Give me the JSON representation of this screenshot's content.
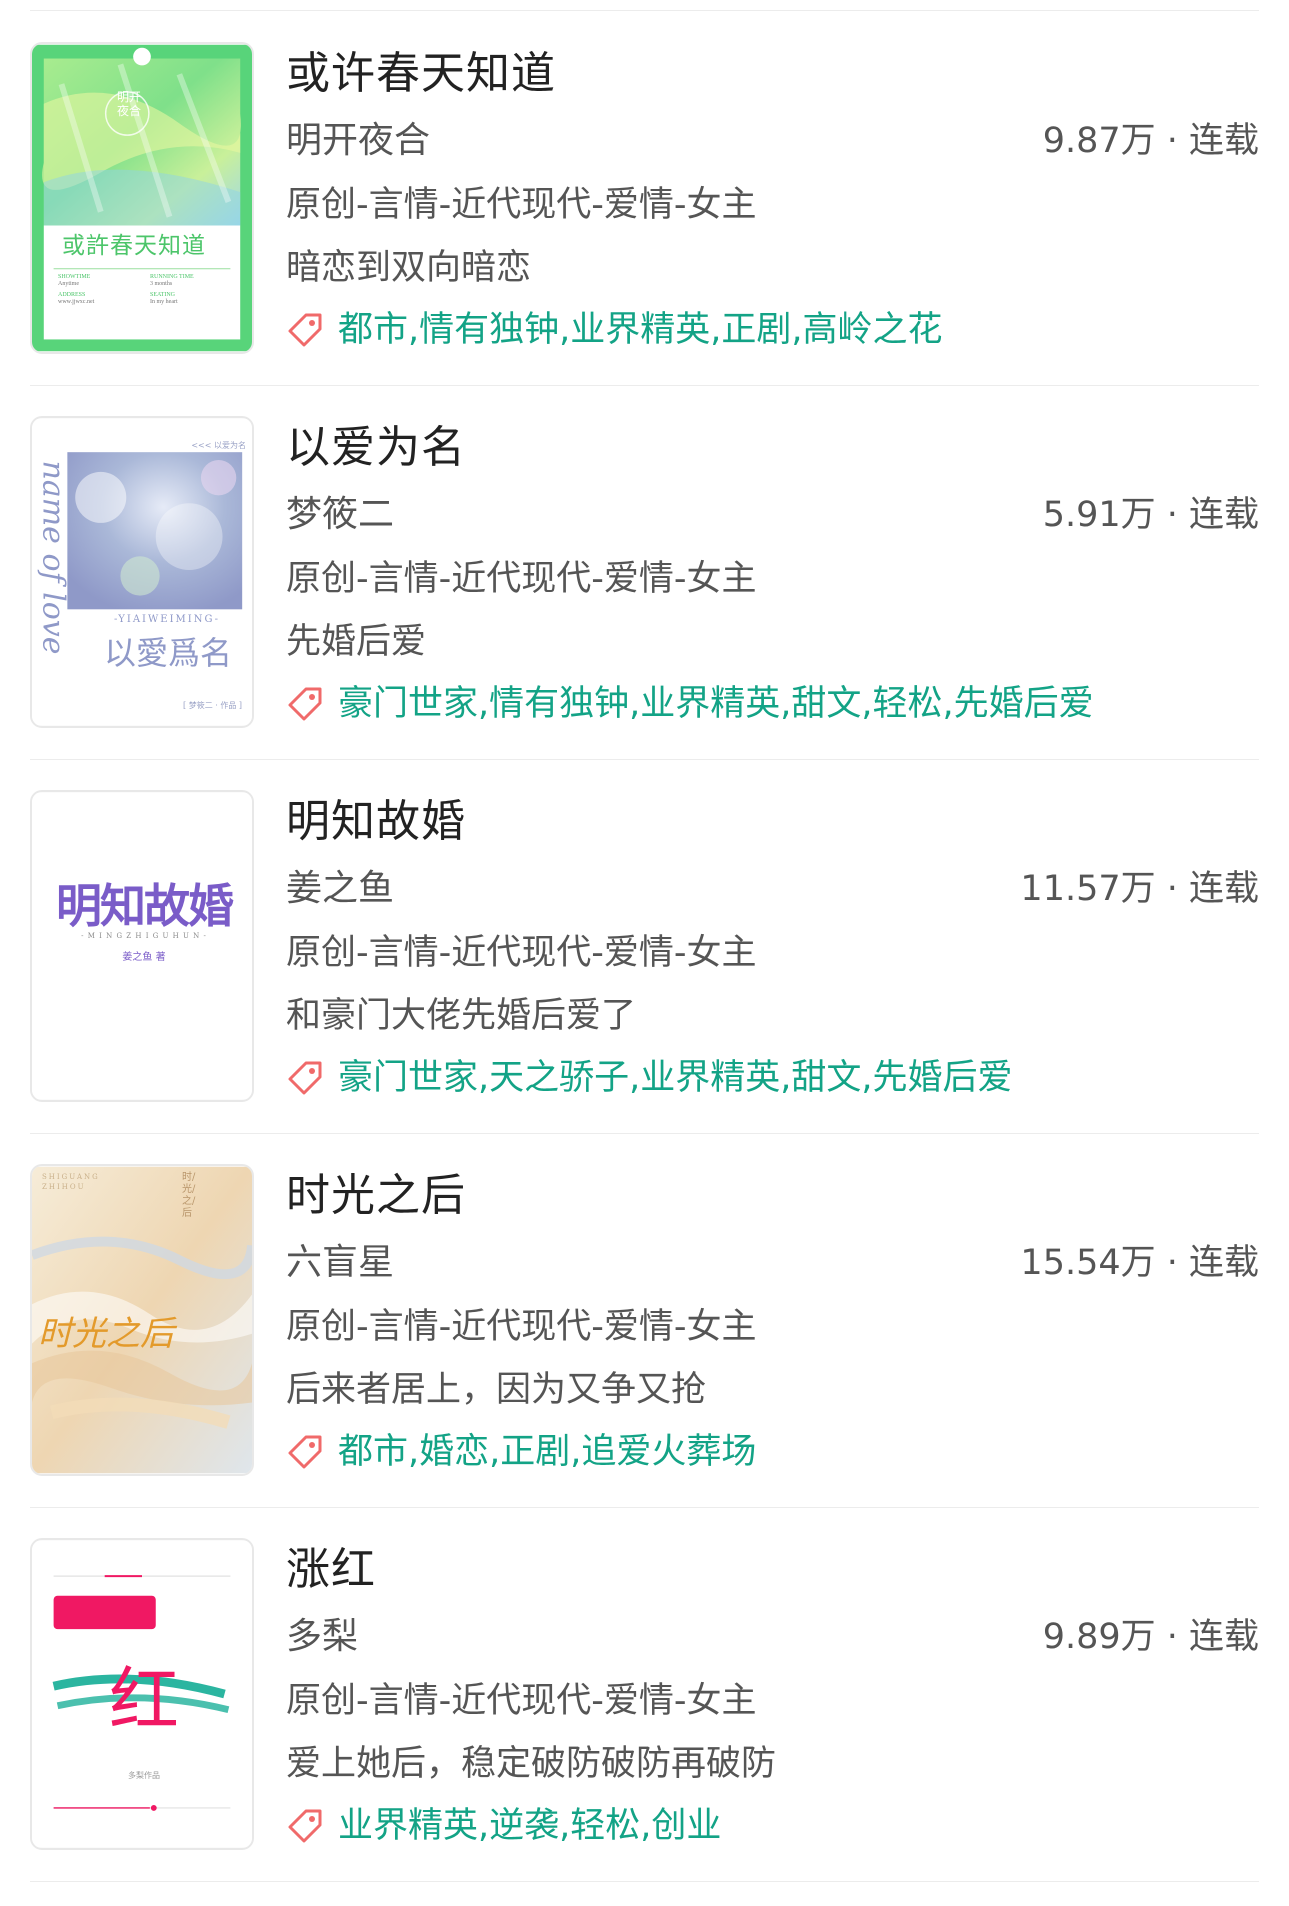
{
  "accent_color": "#13a386",
  "tag_icon_color": "#f06a6a",
  "tag_icon": "tag-icon",
  "books": [
    {
      "title": "或许春天知道",
      "author": "明开夜合",
      "meta": "9.87万 · 连载",
      "category": "原创-言情-近代现代-爱情-女主",
      "blurb": "暗恋到双向暗恋",
      "tags": "都市,情有独钟,业界精英,正剧,高岭之花",
      "cover": {
        "title": "或許春天知道",
        "seal": "明开夜合",
        "colors": [
          "#7fe08a",
          "#c9f09a",
          "#9fd8e8"
        ],
        "fine_print": [
          {
            "label": "SHOWTIME",
            "value": "Anytime"
          },
          {
            "label": "RUNNING TIME",
            "value": "3 months"
          },
          {
            "label": "ADDRESS",
            "value": "www.jjwxc.net"
          },
          {
            "label": "SEATING",
            "value": "In my heart"
          }
        ]
      }
    },
    {
      "title": "以爱为名",
      "author": "梦筱二",
      "meta": "5.91万 · 连载",
      "category": "原创-言情-近代现代-爱情-女主",
      "blurb": "先婚后爱",
      "tags": "豪门世家,情有独钟,业界精英,甜文,轻松,先婚后爱",
      "cover": {
        "title": "以愛爲名",
        "pinyin": "-YIAIWEIMING-",
        "script": "name of love",
        "top_note": "<<< 以爱为名",
        "byline": "[ 梦筱二 · 作品 ]",
        "colors": [
          "#aab8d8",
          "#d6dcef",
          "#8f99c8"
        ]
      }
    },
    {
      "title": "明知故婚",
      "author": "姜之鱼",
      "meta": "11.57万 · 连载",
      "category": "原创-言情-近代现代-爱情-女主",
      "blurb": "和豪门大佬先婚后爱了",
      "tags": "豪门世家,天之骄子,业界精英,甜文,先婚后爱",
      "cover": {
        "title": "明知故婚",
        "pinyin": "- M I N G Z H I G U H U N -",
        "byline": "姜之鱼 著",
        "colors": [
          "#7a5cc8",
          "#ffffff"
        ]
      }
    },
    {
      "title": "时光之后",
      "author": "六盲星",
      "meta": "15.54万 · 连载",
      "category": "原创-言情-近代现代-爱情-女主",
      "blurb": "后来者居上，因为又争又抢",
      "tags": "都市,婚恋,正剧,追爱火葬场",
      "cover": {
        "title": "时光之后",
        "pinyin": "SHIGUANG ZHIHOU",
        "vertical": "时/光/之/后",
        "colors": [
          "#f2e4c8",
          "#e8c79a",
          "#cfd8e2"
        ]
      }
    },
    {
      "title": "涨红",
      "author": "多梨",
      "meta": "9.89万 · 连载",
      "category": "原创-言情-近代现代-爱情-女主",
      "blurb": "爱上她后，稳定破防破防再破防",
      "tags": "业界精英,逆袭,轻松,创业",
      "cover": {
        "title": "红",
        "byline": "多梨作品",
        "colors": [
          "#f01863",
          "#2bb5a0"
        ]
      }
    }
  ]
}
